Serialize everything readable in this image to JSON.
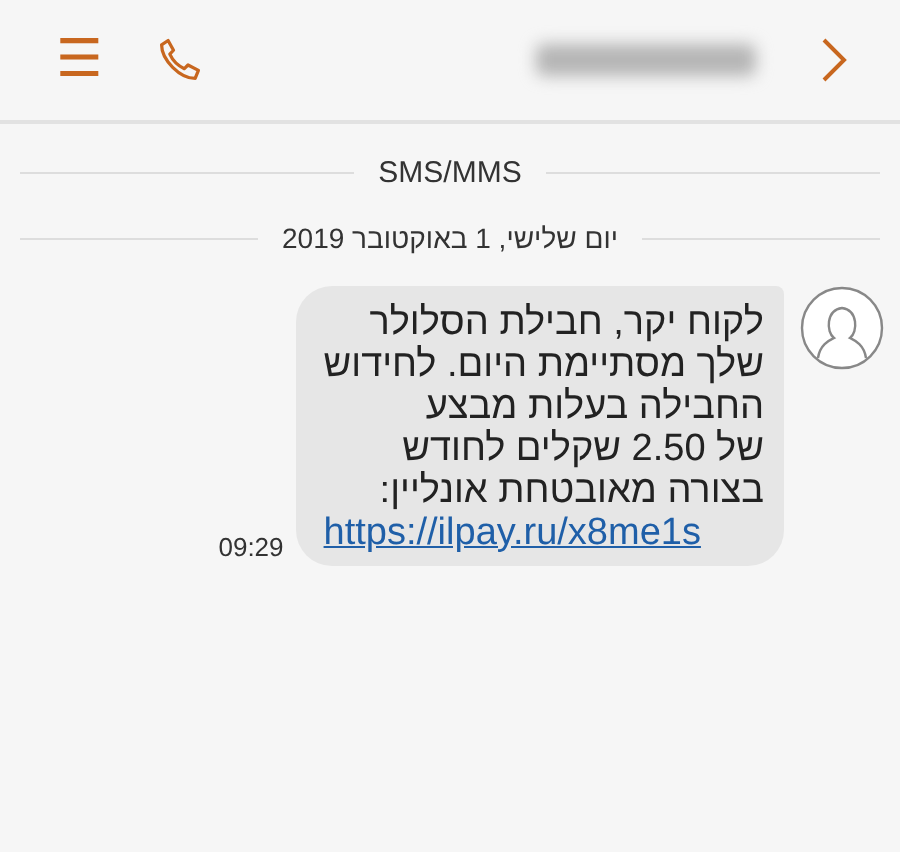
{
  "header": {
    "menu_icon": "☰"
  },
  "channel_label": "SMS/MMS",
  "date_label": "יום שלישי, 1 באוקטובר 2019",
  "message": {
    "lines": [
      "לקוח יקר, חבילת הסלולר",
      "שלך מסתיימת היום. לחידוש",
      "החבילה בעלות מבצע",
      "של 2.50 שקלים לחודש",
      "בצורה מאובטחת אונליין:"
    ],
    "link": "https://ilpay.ru/x8me1s",
    "time": "09:29"
  }
}
